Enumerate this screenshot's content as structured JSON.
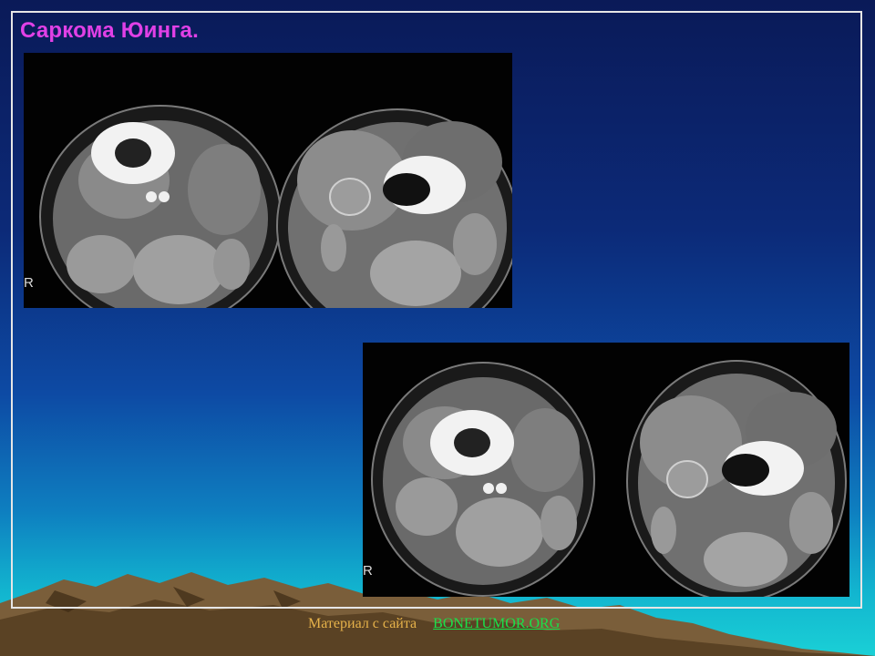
{
  "slide": {
    "title": "Саркома Юинга.",
    "images": [
      {
        "orientation_marker": "R"
      },
      {
        "orientation_marker": "R"
      }
    ],
    "footer": {
      "source_label": "Материал с сайта",
      "link_text": "BONETUMOR.ORG"
    }
  },
  "colors": {
    "title": "#e040e6",
    "footer_text": "#e6b24a",
    "footer_link": "#1ae04a",
    "frame": "#e6e6e6"
  }
}
